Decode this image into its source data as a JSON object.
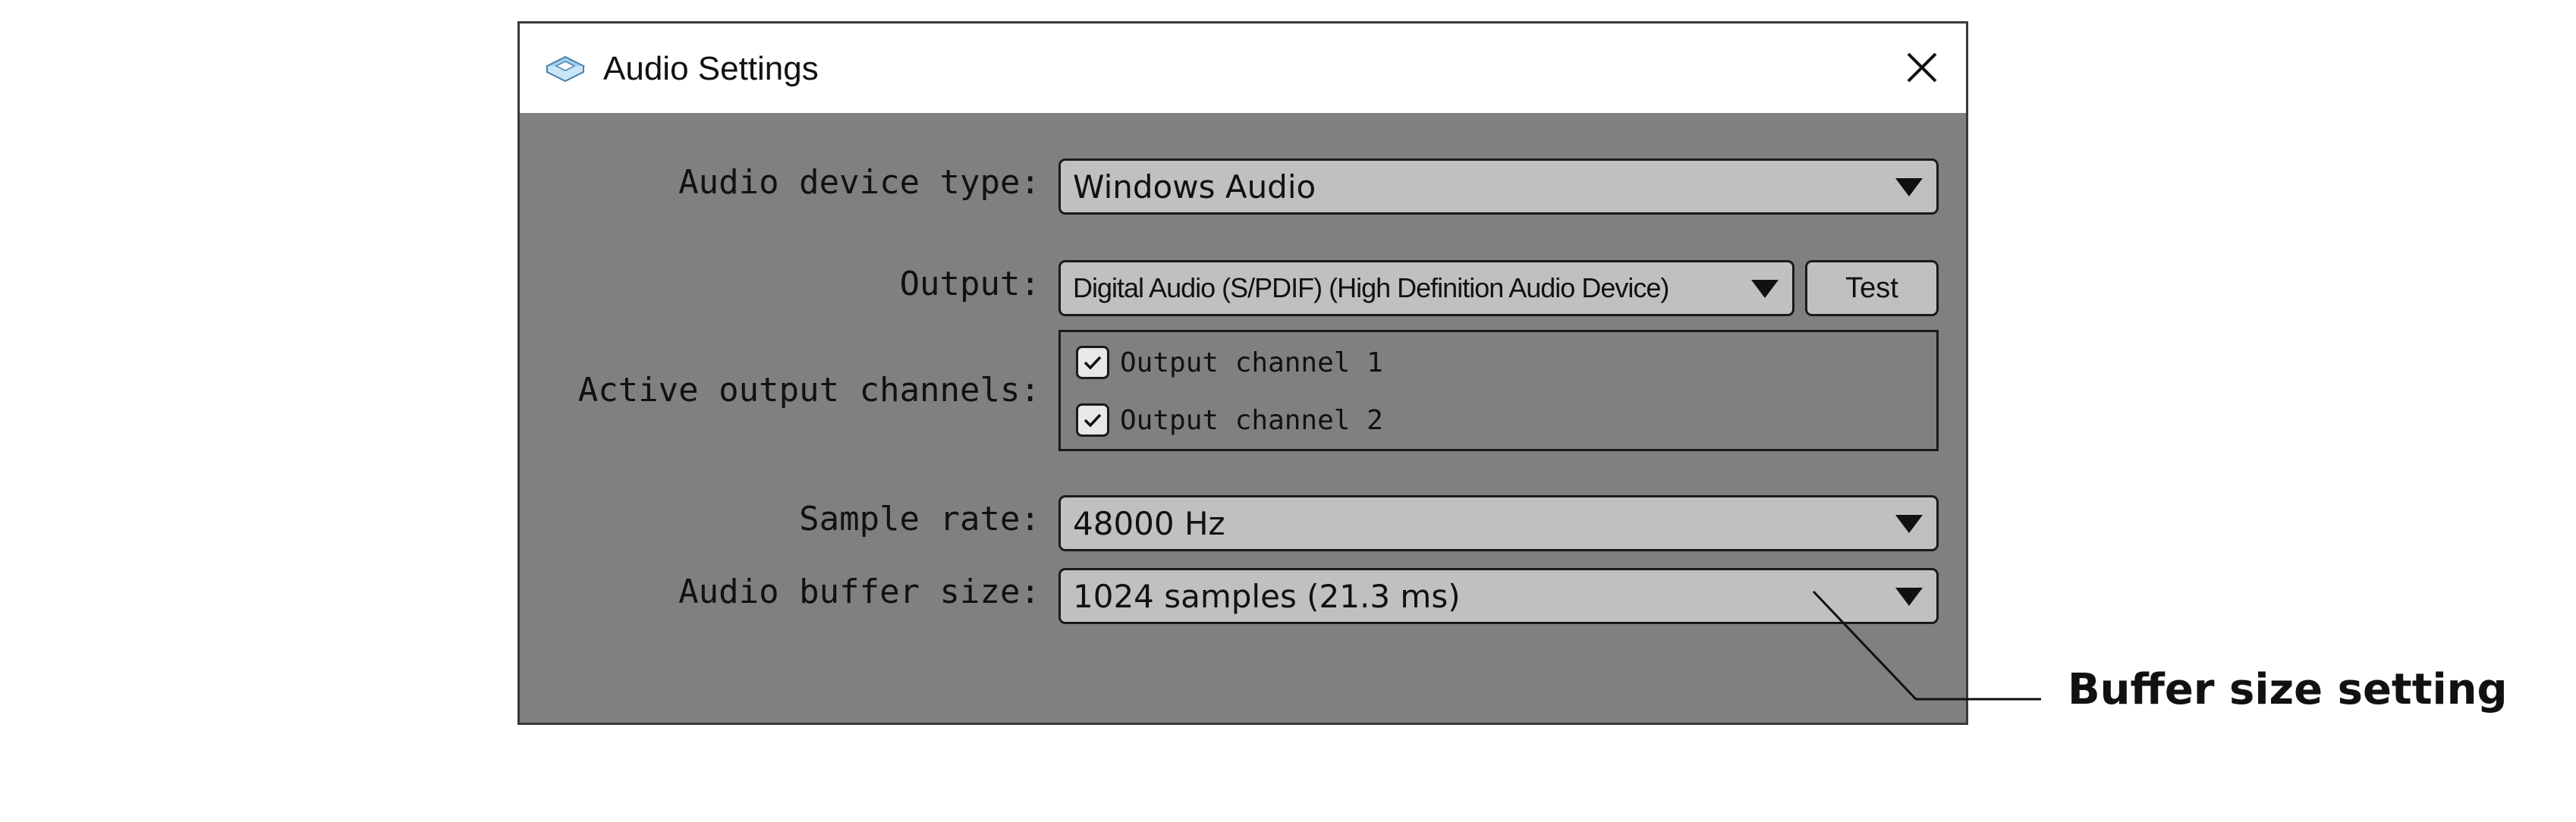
{
  "window": {
    "title": "Audio Settings",
    "icon": "audio-app-icon",
    "close_icon": "close-icon"
  },
  "form": {
    "device_type": {
      "label": "Audio device type:",
      "value": "Windows Audio"
    },
    "output": {
      "label": "Output:",
      "value": "Digital Audio (S/PDIF) (High Definition Audio Device)",
      "test_label": "Test"
    },
    "channels": {
      "label": "Active output channels:",
      "items": [
        {
          "label": "Output channel 1",
          "checked": true
        },
        {
          "label": "Output channel 2",
          "checked": true
        }
      ]
    },
    "sample_rate": {
      "label": "Sample rate:",
      "value": "48000 Hz"
    },
    "buffer_size": {
      "label": "Audio buffer size:",
      "value": "1024 samples (21.3 ms)"
    }
  },
  "annotation": {
    "text": "Buffer size setting"
  },
  "colors": {
    "panel": "#808080",
    "control": "#c0c0c0",
    "border": "#1a1a1a"
  }
}
